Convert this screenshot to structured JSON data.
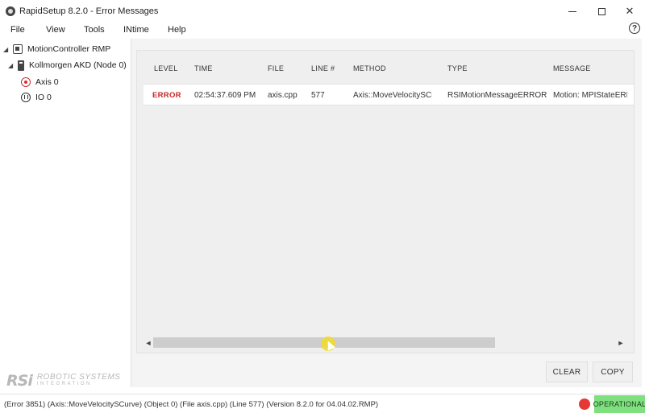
{
  "window": {
    "title": "RapidSetup 8.2.0 - Error Messages",
    "minimize": "—",
    "maximize": "☐",
    "close": "✕"
  },
  "menu": {
    "items": [
      "File",
      "View",
      "Tools",
      "INtime",
      "Help"
    ],
    "help_icon": "?"
  },
  "sidebar": {
    "tree": [
      {
        "label": "MotionController RMP",
        "icon": "chip-icon",
        "expander": "◢"
      },
      {
        "label": "Kollmorgen AKD (Node 0)",
        "icon": "drive-icon",
        "expander": "◢"
      },
      {
        "label": "Axis 0",
        "icon": "axis-icon",
        "status_color": "#d32f2f"
      },
      {
        "label": "IO 0",
        "icon": "io-icon"
      }
    ]
  },
  "logo": {
    "mark": "RSi",
    "name": "ROBOTIC SYSTEMS",
    "tagline": "INTEGRATION"
  },
  "grid": {
    "columns": [
      "LEVEL",
      "TIME",
      "FILE",
      "LINE #",
      "METHOD",
      "TYPE",
      "MESSAGE"
    ],
    "rows": [
      {
        "level": "ERROR",
        "time": "02:54:37.609 PM",
        "file": "axis.cpp",
        "line": "577",
        "method": "Axis::MoveVelocitySCur",
        "type": "RSIMotionMessageERROR",
        "message": "Motion: MPIStateERR"
      }
    ],
    "scroll_left": "◄",
    "scroll_right": "►"
  },
  "buttons": {
    "clear": "CLEAR",
    "copy": "COPY"
  },
  "status": {
    "text": "(Error 3851) (Axis::MoveVelocitySCurve) (Object 0) (File axis.cpp) (Line 577) (Version 8.2.0 for 04.04.02.RMP)",
    "state": "OPERATIONAL",
    "state_color": "#7fe07f",
    "indicator_color": "#e53935"
  }
}
